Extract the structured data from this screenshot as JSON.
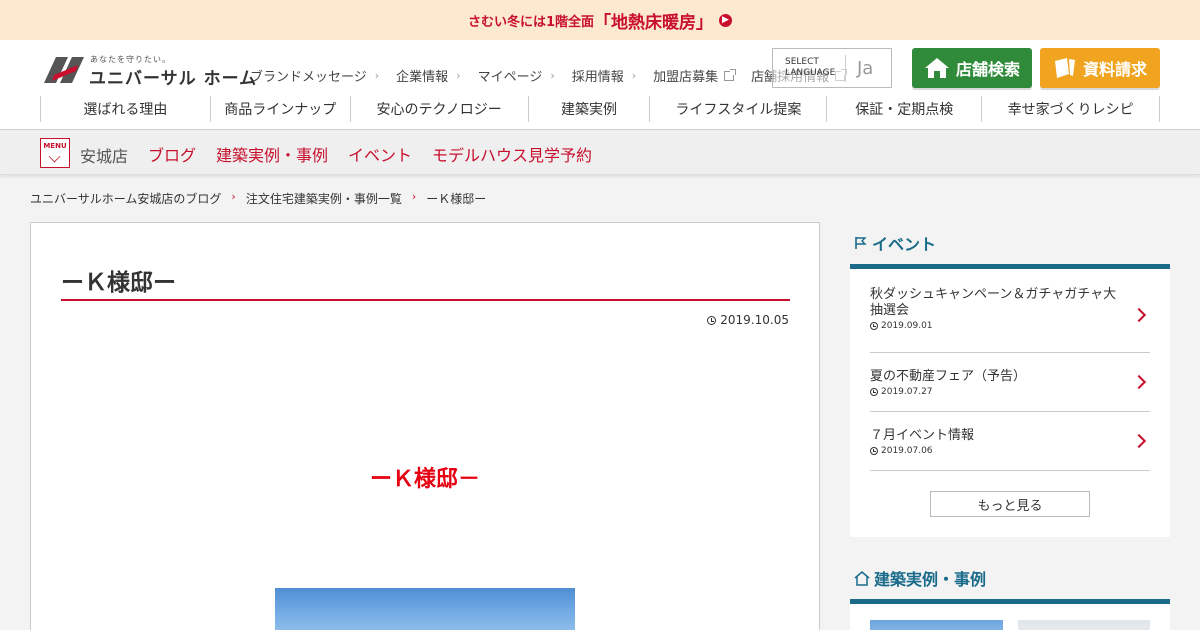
{
  "promo": {
    "text_small": "さむい冬には1階全面",
    "text_big": "「地熱床暖房」"
  },
  "logo": {
    "tagline": "あなたを守りたい。",
    "name": "ユニバーサル ホーム"
  },
  "util_nav": [
    {
      "label": "ブランドメッセージ",
      "external": false
    },
    {
      "label": "企業情報",
      "external": false
    },
    {
      "label": "マイページ",
      "external": false
    },
    {
      "label": "採用情報",
      "external": false
    },
    {
      "label": "加盟店募集",
      "external": true
    },
    {
      "label": "店舗採用情報",
      "external": true
    }
  ],
  "language": {
    "select_label": "SELECT\nLANGUAGE",
    "value": "Ja"
  },
  "buttons": {
    "store_search": "店舗検索",
    "doc_request": "資料請求"
  },
  "global_nav": [
    "選ばれる理由",
    "商品ラインナップ",
    "安心のテクノロジー",
    "建築実例",
    "ライフスタイル提案",
    "保証・定期点検",
    "幸せ家づくりレシピ"
  ],
  "sub_nav": {
    "menu_label": "MENU",
    "store": "安城店",
    "links": [
      "ブログ",
      "建築実例・事例",
      "イベント",
      "モデルハウス見学予約"
    ]
  },
  "breadcrumb": [
    "ユニバーサルホーム安城店のブログ",
    "注文住宅建築実例・事例一覧",
    "ーＫ様邸ー"
  ],
  "article": {
    "title": "ーＫ様邸ー",
    "date": "2019.10.05",
    "heading": "ーＫ様邸－"
  },
  "sidebar": {
    "events": {
      "title": "イベント",
      "items": [
        {
          "title": "秋ダッシュキャンペーン＆ガチャガチャ大抽選会",
          "date": "2019.09.01"
        },
        {
          "title": "夏の不動産フェア（予告）",
          "date": "2019.07.27"
        },
        {
          "title": "７月イベント情報",
          "date": "2019.07.06"
        }
      ],
      "more": "もっと見る"
    },
    "cases": {
      "title": "建築実例・事例"
    }
  },
  "colors": {
    "brand_red": "#c8102e",
    "store_green": "#2f8b3a",
    "doc_orange": "#f0a41f",
    "sidebar_blue": "#1a6b8a"
  }
}
